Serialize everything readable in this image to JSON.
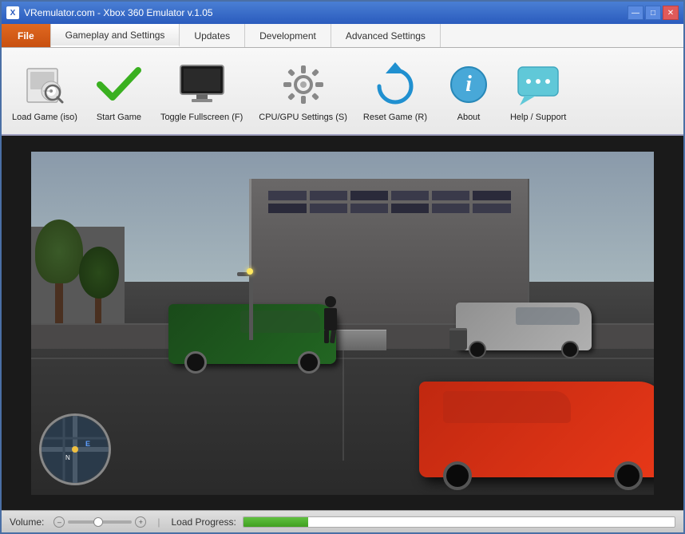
{
  "window": {
    "title": "VRemulator.com - Xbox 360 Emulator v.1.05",
    "icon": "X"
  },
  "title_buttons": {
    "minimize": "—",
    "maximize": "□",
    "close": "✕"
  },
  "tabs": [
    {
      "id": "file",
      "label": "File",
      "active": false,
      "class": "file"
    },
    {
      "id": "gameplay",
      "label": "Gameplay and Settings",
      "active": true,
      "class": "active"
    },
    {
      "id": "updates",
      "label": "Updates",
      "active": false,
      "class": ""
    },
    {
      "id": "development",
      "label": "Development",
      "active": false,
      "class": ""
    },
    {
      "id": "advanced",
      "label": "Advanced Settings",
      "active": false,
      "class": ""
    }
  ],
  "toolbar": {
    "buttons": [
      {
        "id": "load-game",
        "label": "Load Game (iso)",
        "icon": "load"
      },
      {
        "id": "start-game",
        "label": "Start Game",
        "icon": "start"
      },
      {
        "id": "toggle-fullscreen",
        "label": "Toggle Fullscreen (F)",
        "icon": "fullscreen"
      },
      {
        "id": "cpu-gpu-settings",
        "label": "CPU/GPU Settings (S)",
        "icon": "cpu"
      },
      {
        "id": "reset-game",
        "label": "Reset Game (R)",
        "icon": "reset"
      },
      {
        "id": "about",
        "label": "About",
        "icon": "about"
      },
      {
        "id": "help-support",
        "label": "Help / Support",
        "icon": "help"
      }
    ]
  },
  "status_bar": {
    "volume_label": "Volume:",
    "volume_min": "–",
    "volume_max": "+",
    "separator": "|",
    "load_progress_label": "Load Progress:",
    "progress_percent": 15
  },
  "colors": {
    "file_tab": "#c85010",
    "active_tab_bg": "#ffffff",
    "ribbon_bg": "#f0f0f0",
    "progress_fill": "#40a020"
  }
}
